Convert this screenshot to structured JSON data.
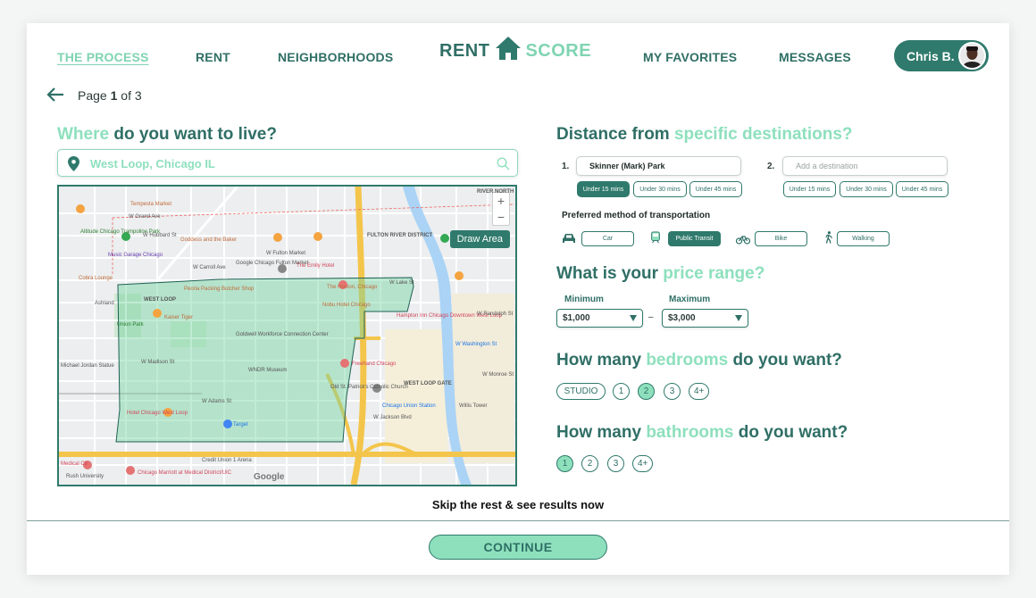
{
  "nav": {
    "process": "THE PROCESS",
    "rent": "RENT",
    "neighborhoods": "NEIGHBORHOODS",
    "logo_rent": "RENT",
    "logo_score": "SCORE",
    "favorites": "MY FAVORITES",
    "messages": "MESSAGES",
    "user_name": "Chris B."
  },
  "page": {
    "prefix": "Page",
    "current": "1",
    "of": "of",
    "total": "3"
  },
  "where": {
    "title_accent": "Where",
    "title_rest": "do you want to live?",
    "search_value": "West Loop, Chicago IL",
    "draw_area": "Draw Area",
    "zoom_in": "+",
    "zoom_out": "−",
    "google": "Google",
    "map_labels": {
      "l1": "Tempesta Market",
      "l2": "Altitude Chicago Trampoline Park",
      "l3": "Music Garage Chicago",
      "l4": "Goddess and the Baker",
      "l5": "Google Chicago Fulton Market",
      "l6": "The Emily Hotel",
      "l7": "FULTON RIVER DISTRICT",
      "l8": "Peoria Packing Butcher Shop",
      "l9": "WEST LOOP",
      "l10": "The Hoxton, Chicago",
      "l11": "Nobu Hotel Chicago",
      "l12": "Kaiser Tiger",
      "l13": "Union Park",
      "l14": "Goldwell Workforce Connection Center",
      "l15": "Hampton Inn Chicago Downtown West Loop",
      "l16": "WNDR Museum",
      "l17": "Freehand Chicago",
      "l18": "WEST LOOP GATE",
      "l19": "Old St. Patrick's Catholic Church",
      "l20": "Chicago Union Station",
      "l21": "Willis Tower",
      "l22": "Hotel Chicago West Loop",
      "l23": "Target",
      "l24": "Medical Ctr",
      "l25": "Chicago Marriott at Medical District/UIC",
      "l26": "Credit Union 1 Arena",
      "l27": "RIVER NORTH",
      "l28": "Cobra Lounge",
      "l29": "Michael Jordan Statue",
      "l30": "W Madison St",
      "l31": "W Adams St",
      "l32": "W Jackson Blvd",
      "l33": "W Randolph St",
      "l34": "W Washington St",
      "l35": "W Monroe St",
      "l36": "W Grand Ave",
      "l37": "W Hubbard St",
      "l38": "W Lake St",
      "l39": "W Carroll Ave",
      "l40": "W Fulton Market",
      "l41": "Ashland",
      "l42": "Rush University"
    }
  },
  "distance": {
    "title_rest": "Distance from",
    "title_accent": "specific destinations?",
    "num1": "1.",
    "num2": "2.",
    "dest1_value": "Skinner (Mark) Park",
    "dest2_placeholder": "Add a destination",
    "times": [
      "Under 15 mins",
      "Under 30 mins",
      "Under 45 mins"
    ],
    "pref_label": "Preferred method of transportation",
    "modes": [
      "Car",
      "Public Transit",
      "Bike",
      "Walking"
    ]
  },
  "price": {
    "title_rest": "What is your",
    "title_accent": "price range?",
    "min_label": "Minimum",
    "max_label": "Maximum",
    "min_value": "$1,000",
    "max_value": "$3,000",
    "dash": "–"
  },
  "bedrooms": {
    "title_pre": "How many",
    "title_accent": "bedrooms",
    "title_post": "do you want?",
    "options": [
      "STUDIO",
      "1",
      "2",
      "3",
      "4+"
    ],
    "selected": "2"
  },
  "bathrooms": {
    "title_pre": "How many",
    "title_accent": "bathrooms",
    "title_post": "do you want?",
    "options": [
      "1",
      "2",
      "3",
      "4+"
    ],
    "selected": "1"
  },
  "footer": {
    "skip": "Skip the rest & see results now",
    "continue": "CONTINUE"
  },
  "colors": {
    "primary": "#2f7a6c",
    "accent": "#8ee0bd",
    "text_dark": "#2f6f66"
  }
}
